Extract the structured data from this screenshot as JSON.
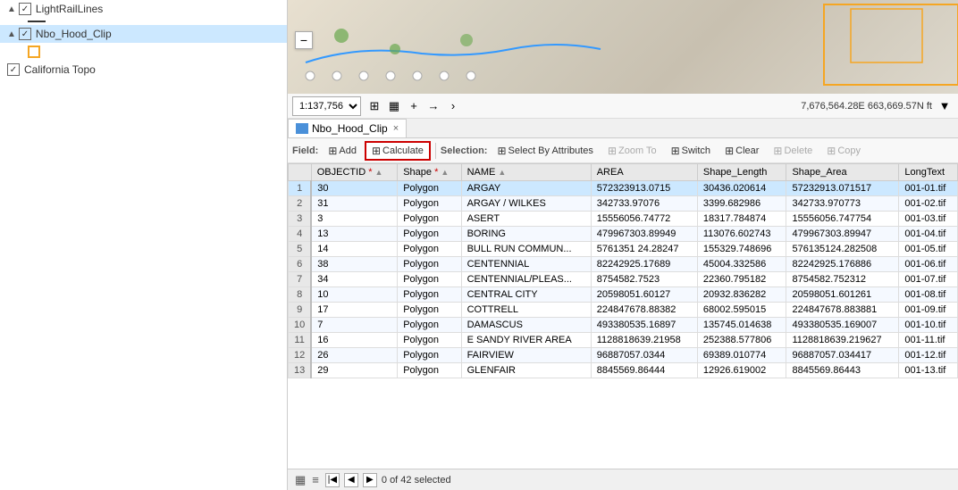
{
  "layers": {
    "items": [
      {
        "id": "light-rail",
        "label": "LightRailLines",
        "checked": true,
        "indent": 0,
        "icon": "line",
        "collapsed": false
      },
      {
        "id": "nbo-hood",
        "label": "Nbo_Hood_Clip",
        "checked": true,
        "indent": 0,
        "icon": "rect-blue",
        "selected": true,
        "collapsed": false
      },
      {
        "id": "california-topo",
        "label": "California Topo",
        "checked": true,
        "indent": 0,
        "icon": "none",
        "collapsed": false
      }
    ]
  },
  "toolbar": {
    "scale": "1:137,756",
    "scale_options": [
      "1:137,756"
    ],
    "coord_text": "7,676,564.28E 663,669.57N ft",
    "collapse_icon": "▼"
  },
  "tab": {
    "label": "Nbo_Hood_Clip",
    "close": "×"
  },
  "attr_toolbar": {
    "field_label": "Field:",
    "add_label": "Add",
    "calculate_label": "Calculate",
    "selection_label": "Selection:",
    "select_by_attr_label": "Select By Attributes",
    "zoom_to_label": "Zoom To",
    "switch_label": "Switch",
    "clear_label": "Clear",
    "delete_label": "Delete",
    "copy_label": "Copy"
  },
  "table": {
    "columns": [
      {
        "id": "objectid",
        "label": "OBJECTID *",
        "sort": true
      },
      {
        "id": "shape",
        "label": "Shape *",
        "sort": true
      },
      {
        "id": "name",
        "label": "NAME",
        "sort": true
      },
      {
        "id": "area",
        "label": "AREA",
        "sort": false
      },
      {
        "id": "shape_length",
        "label": "Shape_Length",
        "sort": false
      },
      {
        "id": "shape_area",
        "label": "Shape_Area",
        "sort": false
      },
      {
        "id": "longtext",
        "label": "LongText",
        "sort": false
      }
    ],
    "rows": [
      {
        "num": 1,
        "objectid": "30",
        "shape": "Polygon",
        "name": "ARGAY",
        "area": "572323913.0715",
        "shape_length": "30436.020614",
        "shape_area": "57232913.071517",
        "longtext": "001-01.tif",
        "selected": true
      },
      {
        "num": 2,
        "objectid": "31",
        "shape": "Polygon",
        "name": "ARGAY / WILKES",
        "area": "342733.97076",
        "shape_length": "3399.682986",
        "shape_area": "342733.970773",
        "longtext": "001-02.tif",
        "selected": false
      },
      {
        "num": 3,
        "objectid": "3",
        "shape": "Polygon",
        "name": "ASERT",
        "area": "15556056.74772",
        "shape_length": "18317.784874",
        "shape_area": "15556056.747754",
        "longtext": "001-03.tif",
        "selected": false
      },
      {
        "num": 4,
        "objectid": "13",
        "shape": "Polygon",
        "name": "BORING",
        "area": "479967303.89949",
        "shape_length": "113076.602743",
        "shape_area": "479967303.89947",
        "longtext": "001-04.tif",
        "selected": false
      },
      {
        "num": 5,
        "objectid": "14",
        "shape": "Polygon",
        "name": "BULL RUN COMMUN...",
        "area": "5761351 24.28247",
        "shape_length": "155329.748696",
        "shape_area": "576135124.282508",
        "longtext": "001-05.tif",
        "selected": false
      },
      {
        "num": 6,
        "objectid": "38",
        "shape": "Polygon",
        "name": "CENTENNIAL",
        "area": "82242925.17689",
        "shape_length": "45004.332586",
        "shape_area": "82242925.176886",
        "longtext": "001-06.tif",
        "selected": false
      },
      {
        "num": 7,
        "objectid": "34",
        "shape": "Polygon",
        "name": "CENTENNIAL/PLEAS...",
        "area": "8754582.7523",
        "shape_length": "22360.795182",
        "shape_area": "8754582.752312",
        "longtext": "001-07.tif",
        "selected": false
      },
      {
        "num": 8,
        "objectid": "10",
        "shape": "Polygon",
        "name": "CENTRAL CITY",
        "area": "20598051.60127",
        "shape_length": "20932.836282",
        "shape_area": "20598051.601261",
        "longtext": "001-08.tif",
        "selected": false
      },
      {
        "num": 9,
        "objectid": "17",
        "shape": "Polygon",
        "name": "COTTRELL",
        "area": "224847678.88382",
        "shape_length": "68002.595015",
        "shape_area": "224847678.883881",
        "longtext": "001-09.tif",
        "selected": false
      },
      {
        "num": 10,
        "objectid": "7",
        "shape": "Polygon",
        "name": "DAMASCUS",
        "area": "493380535.16897",
        "shape_length": "135745.014638",
        "shape_area": "493380535.169007",
        "longtext": "001-10.tif",
        "selected": false
      },
      {
        "num": 11,
        "objectid": "16",
        "shape": "Polygon",
        "name": "E SANDY RIVER AREA",
        "area": "1128818639.21958",
        "shape_length": "252388.577806",
        "shape_area": "1128818639.219627",
        "longtext": "001-11.tif",
        "selected": false
      },
      {
        "num": 12,
        "objectid": "26",
        "shape": "Polygon",
        "name": "FAIRVIEW",
        "area": "96887057.0344",
        "shape_length": "69389.010774",
        "shape_area": "96887057.034417",
        "longtext": "001-12.tif",
        "selected": false
      },
      {
        "num": 13,
        "objectid": "29",
        "shape": "Polygon",
        "name": "GLENFAIR",
        "area": "8845569.86444",
        "shape_length": "12926.619002",
        "shape_area": "8845569.86443",
        "longtext": "001-13.tif",
        "selected": false
      }
    ]
  },
  "status_bar": {
    "selected_text": "0 of 42 selected"
  },
  "colors": {
    "selected_row": "#cce8ff",
    "accent_blue": "#4a90d9",
    "tab_icon": "#4a90d9"
  }
}
